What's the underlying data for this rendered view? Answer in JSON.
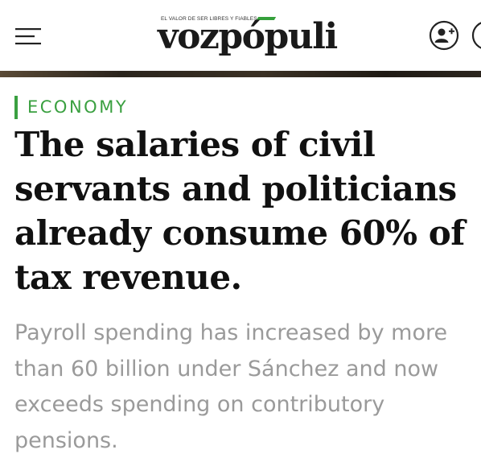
{
  "header": {
    "logo_tagline": "EL VALOR DE SER LIBRES Y FIABLES",
    "logo_text": "vozpópuli",
    "logo_bar_color": "#35a03b",
    "menu_icon": "hamburger-menu-icon",
    "user_icon": "user-add-icon"
  },
  "article": {
    "section": "ECONOMY",
    "section_color": "#3aa040",
    "headline_lines": [
      "The salaries of civil",
      "servants and politicians",
      "already consume 60% of",
      "tax revenue."
    ],
    "subtitle_lines": [
      "Payroll spending has increased by more",
      "than 60 billion under Sánchez and now",
      "exceeds spending on contributory",
      "pensions."
    ]
  }
}
